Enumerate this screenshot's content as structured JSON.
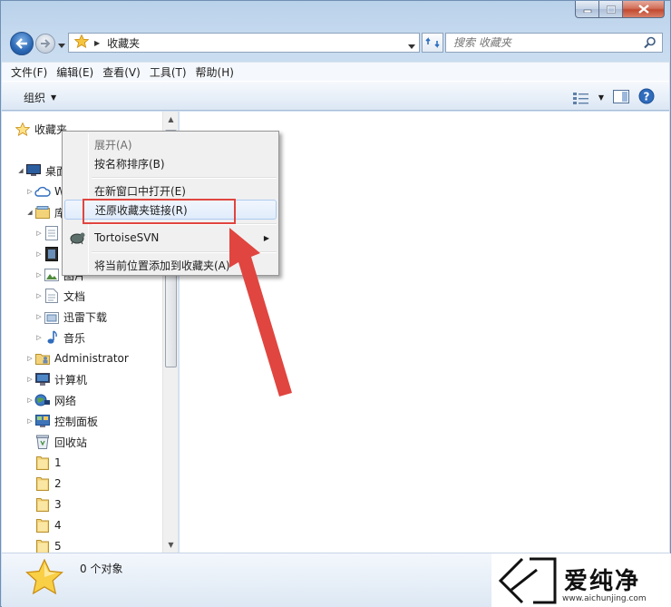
{
  "window": {
    "caption_buttons": [
      "minimize-icon",
      "maximize-icon",
      "close-icon"
    ]
  },
  "address": {
    "crumb": "收藏夹",
    "search_placeholder": "搜索 收藏夹"
  },
  "menubar": {
    "items": [
      "文件(F)",
      "编辑(E)",
      "查看(V)",
      "工具(T)",
      "帮助(H)"
    ]
  },
  "toolbar": {
    "organize_label": "组织"
  },
  "nav_tree": {
    "favorites": "收藏夹",
    "desktop": "桌面",
    "onedrive": "W",
    "libraries": "库",
    "lib_items": [
      "",
      "",
      "图片",
      "文档",
      "迅雷下载",
      "音乐"
    ],
    "administrator": "Administrator",
    "computer": "计算机",
    "network": "网络",
    "control_panel": "控制面板",
    "recycle_bin": "回收站",
    "folders": [
      "1",
      "2",
      "3",
      "4",
      "5"
    ]
  },
  "context_menu": {
    "items": [
      {
        "label": "展开(A)",
        "disabled": true
      },
      {
        "label": "按名称排序(B)",
        "disabled": false
      },
      {
        "label": "在新窗口中打开(E)",
        "disabled": false
      },
      {
        "label": "还原收藏夹链接(R)",
        "disabled": false
      },
      {
        "label": "TortoiseSVN",
        "disabled": false
      },
      {
        "label": "将当前位置添加到收藏夹(A)",
        "disabled": false
      }
    ]
  },
  "statusbar": {
    "count": "0 个对象"
  },
  "watermark": {
    "brand": "爱纯净",
    "url": "www.aichunjing.com"
  },
  "colors": {
    "highlight_box": "#e0453f",
    "arrow": "#e0453f",
    "accent_blue": "#2a67b4"
  }
}
